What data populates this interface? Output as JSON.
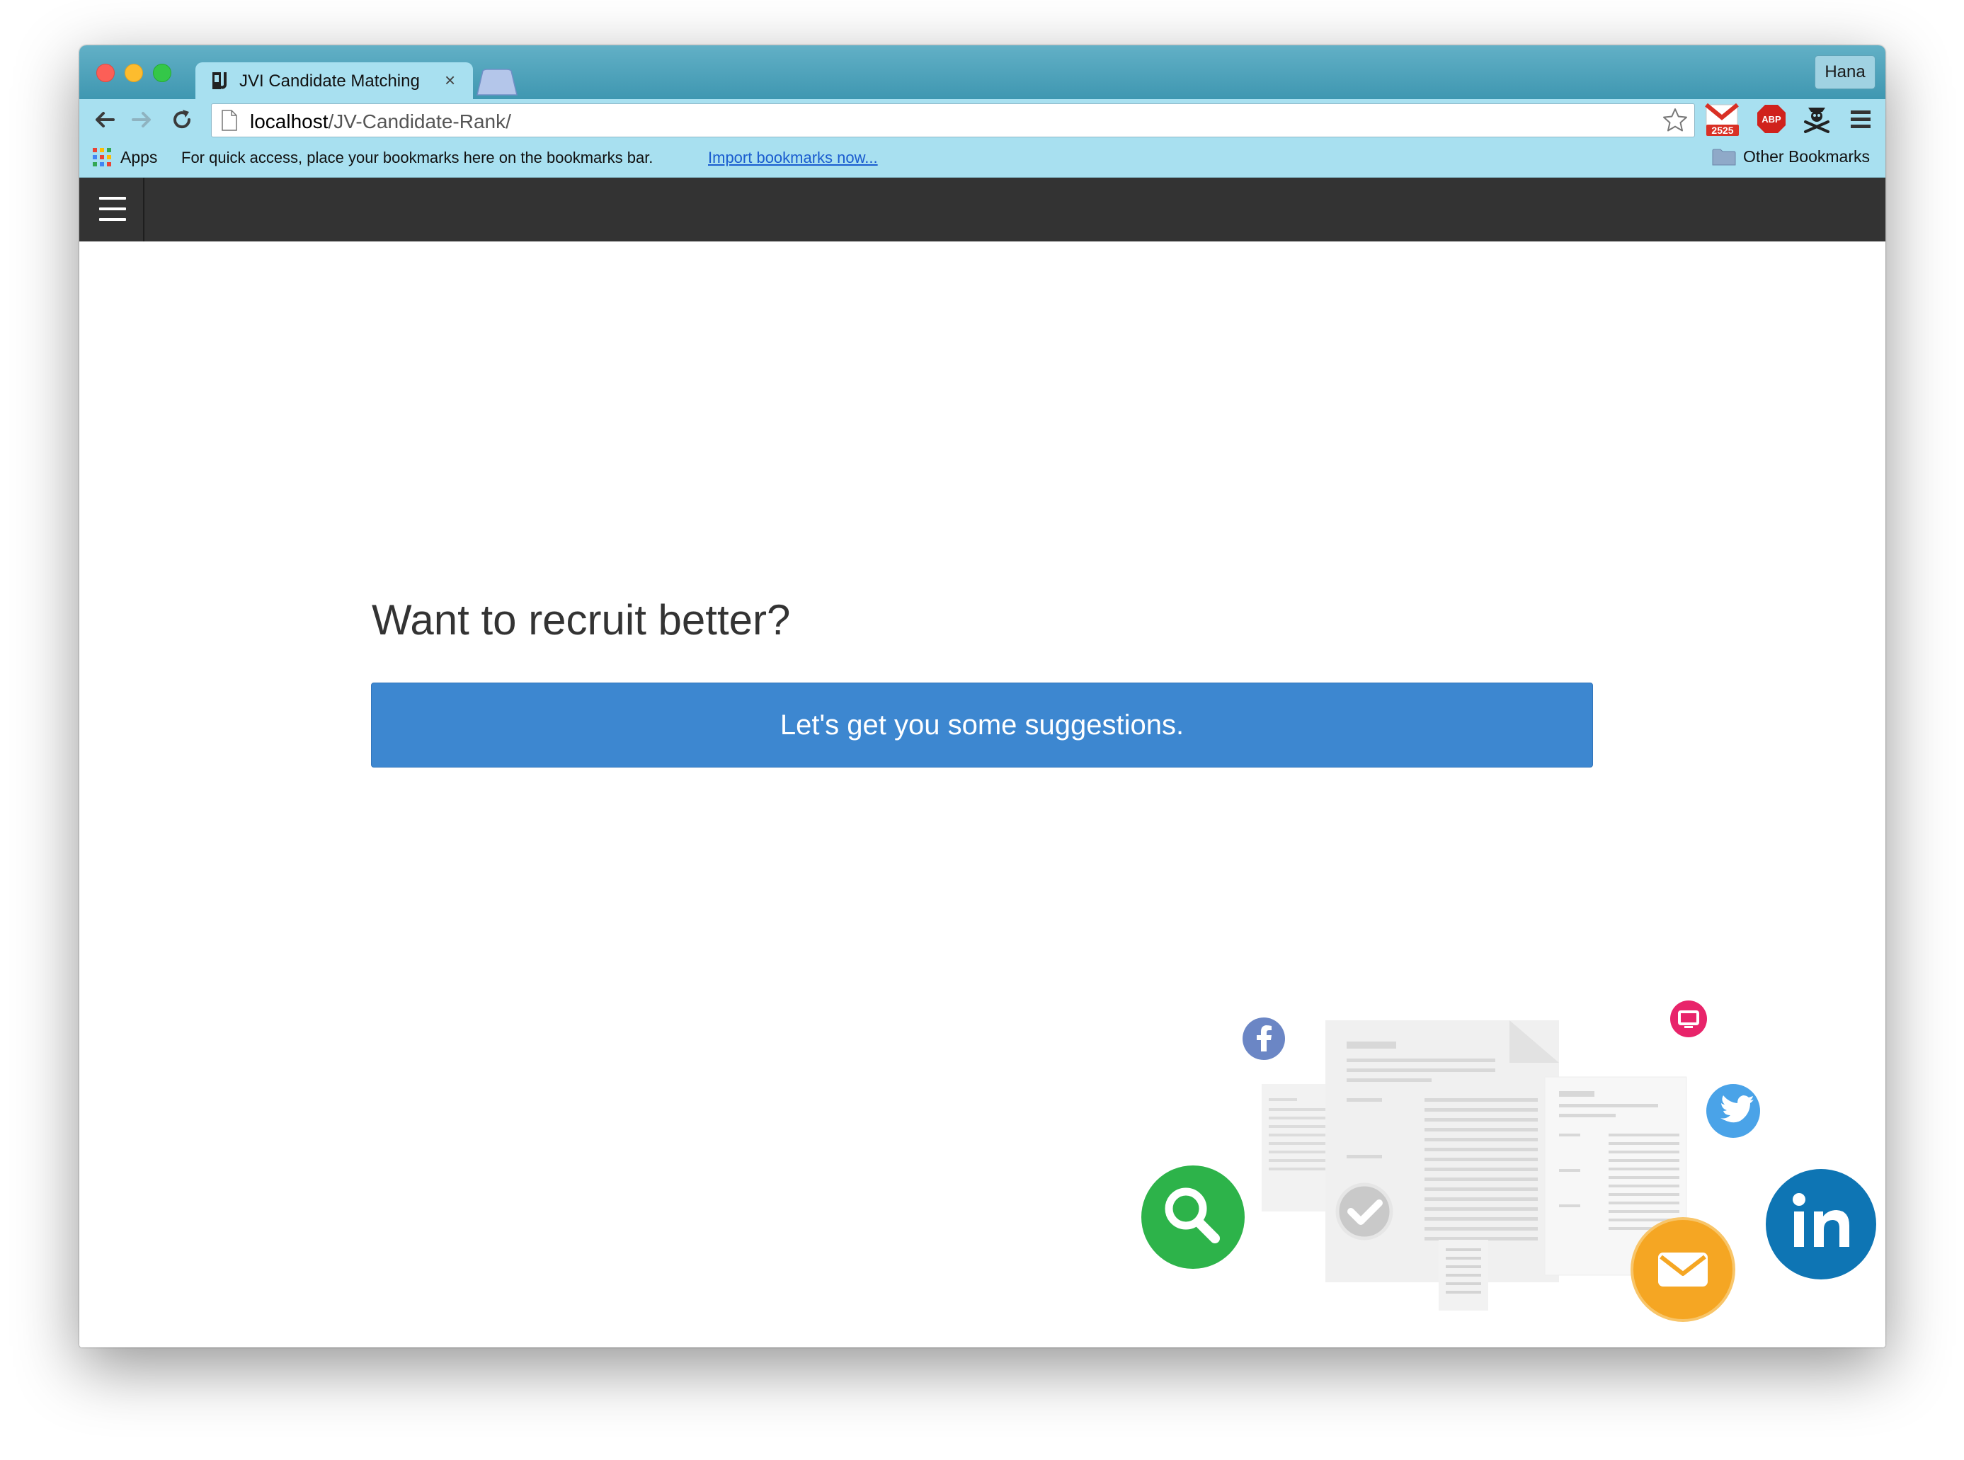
{
  "browser": {
    "tab_title": "JVI Candidate Matching",
    "tab_close": "×",
    "profile_name": "Hana",
    "url_host": "localhost",
    "url_path": "/JV-Candidate-Rank/",
    "gmail_badge": "2525",
    "abp_label": "ABP"
  },
  "bookmarks_bar": {
    "apps_label": "Apps",
    "message": "For quick access, place your bookmarks here on the bookmarks bar.",
    "import_link": "Import bookmarks now...",
    "other_bookmarks": "Other Bookmarks"
  },
  "page": {
    "headline": "Want to recruit better?",
    "cta_label": "Let's get you some suggestions."
  },
  "icons": [
    "back-arrow-icon",
    "forward-arrow-icon",
    "reload-icon",
    "page-icon",
    "star-icon",
    "gmail-icon",
    "adblock-icon",
    "pirate-icon",
    "menu-icon",
    "apps-grid-icon",
    "folder-icon",
    "hamburger-icon",
    "facebook-icon",
    "monitor-icon",
    "twitter-icon",
    "search-icon",
    "linkedin-icon",
    "checkmark-icon",
    "email-icon"
  ],
  "colors": {
    "tabstrip": "#4aa3bc",
    "toolbar": "#a8e0f0",
    "appnav": "#333333",
    "cta": "#3d87d0",
    "facebook": "#6b86c5",
    "monitor": "#e8246a",
    "twitter": "#4aa3e8",
    "search": "#2db34a",
    "linkedin": "#0e75b4",
    "email": "#f5a623"
  }
}
